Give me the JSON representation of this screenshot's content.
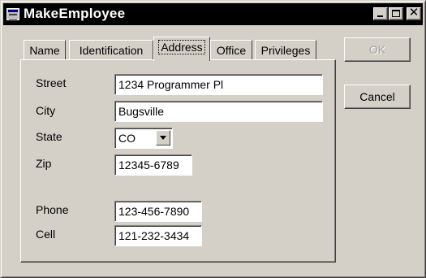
{
  "window": {
    "title": "MakeEmployee"
  },
  "tabs": [
    "Name",
    "Identification",
    "Address",
    "Office",
    "Privileges"
  ],
  "active_tab": "Address",
  "form": {
    "street": {
      "label": "Street",
      "value": "1234 Programmer Pl"
    },
    "city": {
      "label": "City",
      "value": "Bugsville"
    },
    "state": {
      "label": "State",
      "value": "CO"
    },
    "zip": {
      "label": "Zip",
      "value": "12345-6789"
    },
    "phone": {
      "label": "Phone",
      "value": "123-456-7890"
    },
    "cell": {
      "label": "Cell",
      "value": "121-232-3434"
    }
  },
  "buttons": {
    "ok": "OK",
    "cancel": "Cancel"
  },
  "icons": [
    "app-icon",
    "minimize-icon",
    "maximize-icon",
    "close-icon",
    "chevron-down-icon"
  ],
  "colors": {
    "titlebar": "#000000",
    "face": "#d4d0c8",
    "field": "#ffffff",
    "disabled_text": "#a0a0a0"
  }
}
